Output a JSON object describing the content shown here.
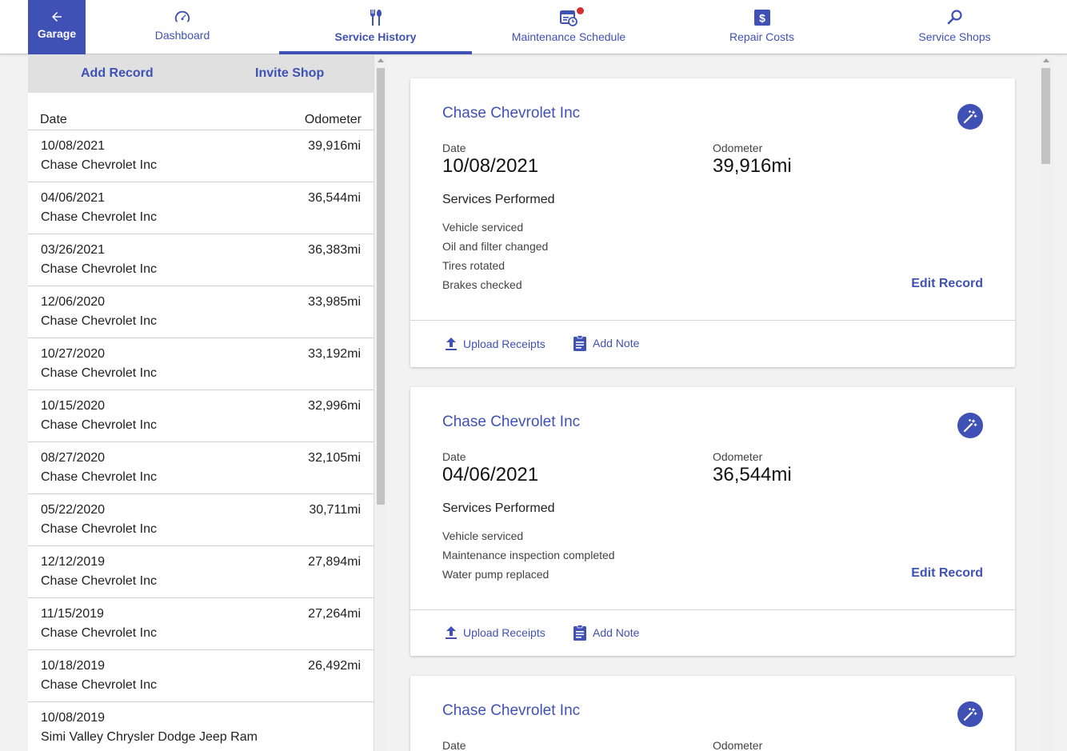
{
  "nav": {
    "garage": "Garage",
    "dashboard": "Dashboard",
    "service_history": "Service History",
    "maintenance_schedule": "Maintenance Schedule",
    "repair_costs": "Repair Costs",
    "service_shops": "Service Shops"
  },
  "left": {
    "add_record": "Add Record",
    "invite_shop": "Invite Shop",
    "col_date": "Date",
    "col_odometer": "Odometer",
    "rows": [
      {
        "date": "10/08/2021",
        "shop": "Chase Chevrolet Inc",
        "odo": "39,916mi"
      },
      {
        "date": "04/06/2021",
        "shop": "Chase Chevrolet Inc",
        "odo": "36,544mi"
      },
      {
        "date": "03/26/2021",
        "shop": "Chase Chevrolet Inc",
        "odo": "36,383mi"
      },
      {
        "date": "12/06/2020",
        "shop": "Chase Chevrolet Inc",
        "odo": "33,985mi"
      },
      {
        "date": "10/27/2020",
        "shop": "Chase Chevrolet Inc",
        "odo": "33,192mi"
      },
      {
        "date": "10/15/2020",
        "shop": "Chase Chevrolet Inc",
        "odo": "32,996mi"
      },
      {
        "date": "08/27/2020",
        "shop": "Chase Chevrolet Inc",
        "odo": "32,105mi"
      },
      {
        "date": "05/22/2020",
        "shop": "Chase Chevrolet Inc",
        "odo": "30,711mi"
      },
      {
        "date": "12/12/2019",
        "shop": "Chase Chevrolet Inc",
        "odo": "27,894mi"
      },
      {
        "date": "11/15/2019",
        "shop": "Chase Chevrolet Inc",
        "odo": "27,264mi"
      },
      {
        "date": "10/18/2019",
        "shop": "Chase Chevrolet Inc",
        "odo": "26,492mi"
      },
      {
        "date": "10/08/2019",
        "shop": "Simi Valley Chrysler Dodge Jeep Ram",
        "odo": ""
      }
    ]
  },
  "cards": [
    {
      "shop": "Chase Chevrolet Inc",
      "date_label": "Date",
      "date": "10/08/2021",
      "odo_label": "Odometer",
      "odo": "39,916mi",
      "services_label": "Services Performed",
      "services": [
        "Vehicle serviced",
        "Oil and filter changed",
        "Tires rotated",
        "Brakes checked"
      ],
      "edit": "Edit Record",
      "upload": "Upload Receipts",
      "note": "Add Note"
    },
    {
      "shop": "Chase Chevrolet Inc",
      "date_label": "Date",
      "date": "04/06/2021",
      "odo_label": "Odometer",
      "odo": "36,544mi",
      "services_label": "Services Performed",
      "services": [
        "Vehicle serviced",
        "Maintenance inspection completed",
        "Water pump replaced"
      ],
      "edit": "Edit Record",
      "upload": "Upload Receipts",
      "note": "Add Note"
    },
    {
      "shop": "Chase Chevrolet Inc",
      "date_label": "Date",
      "odo_label": "Odometer"
    }
  ],
  "colors": {
    "accent": "#3f51b5",
    "notification": "#d32f2f"
  },
  "icons": [
    "back-arrow-icon",
    "speedometer-icon",
    "tools-icon",
    "calendar-clock-icon",
    "dollar-icon",
    "search-icon",
    "magic-wand-icon",
    "upload-icon",
    "clipboard-icon"
  ]
}
